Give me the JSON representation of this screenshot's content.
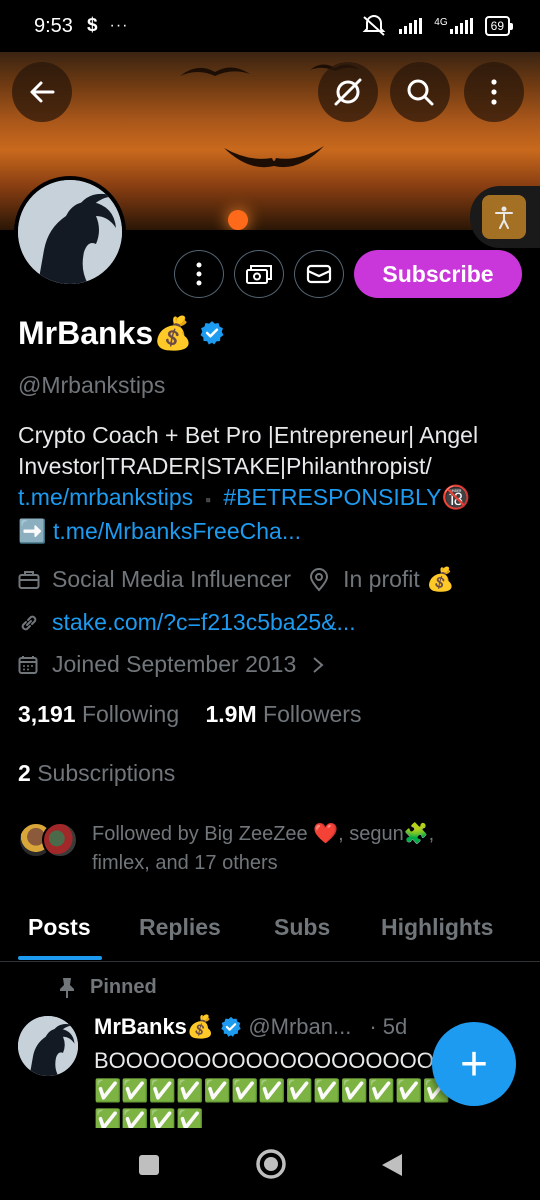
{
  "status_bar": {
    "time": "9:53",
    "app_icon": "$",
    "more": "···",
    "network": "4G",
    "battery": "69"
  },
  "profile": {
    "name": "MrBanks💰",
    "handle": "@Mrbankstips",
    "bio_line1": "Crypto Coach + Bet Pro |Entrepreneur| Angel",
    "bio_line2": "Investor|TRADER|STAKE|Philanthropist/",
    "bio_link1": "t.me/mrbankstips",
    "bio_separator": "▪️",
    "bio_hashtag": "#BETRESPONSIBLY🔞",
    "bio_arrow": "➡️",
    "bio_link2": "t.me/MrbanksFreeCha...",
    "category": "Social Media Influencer",
    "location": "In profit 💰",
    "website": "stake.com/?c=f213c5ba25&...",
    "joined": "Joined September 2013",
    "following_count": "3,191",
    "following_label": "Following",
    "followers_count": "1.9M",
    "followers_label": "Followers",
    "subscriptions_count": "2",
    "subscriptions_label": "Subscriptions",
    "followed_by_line1": "Followed by Big ZeeZee ❤️, segun🧩,",
    "followed_by_line2": "fimlex, and 17 others"
  },
  "actions": {
    "subscribe_label": "Subscribe"
  },
  "tabs": [
    {
      "label": "Posts",
      "active": true
    },
    {
      "label": "Replies",
      "active": false
    },
    {
      "label": "Subs",
      "active": false
    },
    {
      "label": "Highlights",
      "active": false
    }
  ],
  "pinned_post": {
    "pinned_label": "Pinned",
    "author": "MrBanks💰",
    "handle": "@Mrban...",
    "time": "· 5d",
    "text": "BOOOOOOOOOOOOOOOOOOOO",
    "checks_line1": "✅✅✅✅✅✅✅✅✅✅✅✅✅",
    "checks_line2": "✅✅✅✅"
  },
  "fab": {
    "label": "+"
  },
  "colors": {
    "accent": "#1d9bf0",
    "subscribe": "#c936d9",
    "muted": "#71767b",
    "background": "#000000"
  },
  "icons": [
    "back-arrow-icon",
    "grok-icon",
    "search-icon",
    "more-vertical-icon",
    "accessibility-icon",
    "more-icon",
    "tip-money-icon",
    "mail-icon",
    "verified-badge-icon",
    "briefcase-icon",
    "location-pin-icon",
    "link-icon",
    "calendar-icon",
    "chevron-right-icon",
    "pin-icon",
    "compose-plus-icon",
    "nav-recents-icon",
    "nav-home-icon",
    "nav-back-icon"
  ]
}
